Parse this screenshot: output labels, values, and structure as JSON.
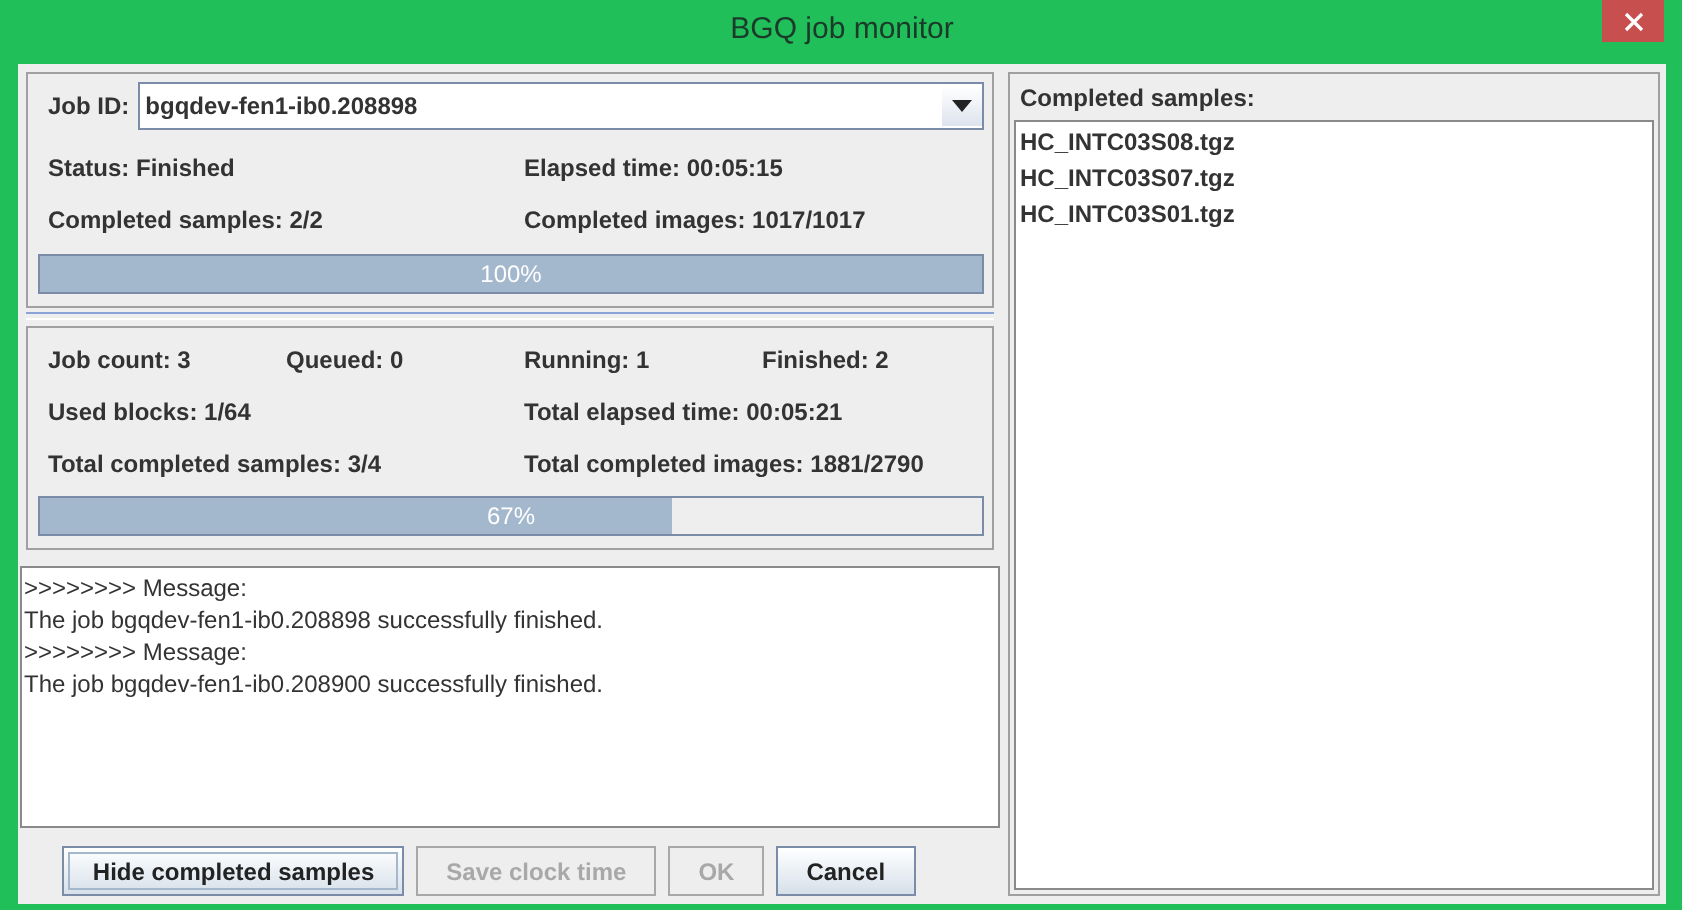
{
  "window": {
    "title": "BGQ job monitor"
  },
  "job_panel": {
    "job_id_label": "Job ID:",
    "job_id": "bgqdev-fen1-ib0.208898",
    "rows": [
      [
        {
          "label": "Status:",
          "value": "Finished"
        },
        {
          "label": "Elapsed time:",
          "value": "00:05:15"
        }
      ],
      [
        {
          "label": "Completed samples:",
          "value": "2/2"
        },
        {
          "label": "Completed images:",
          "value": "1017/1017"
        }
      ]
    ],
    "progress": {
      "level": 1.0,
      "text": "100%"
    }
  },
  "summary_panel": {
    "rows": [
      [
        {
          "label": "Job count:",
          "value": "3"
        },
        {
          "label": "Queued:",
          "value": "0"
        },
        {
          "label": "Running:",
          "value": "1"
        },
        {
          "label": "Finished:",
          "value": "2"
        }
      ],
      [
        {
          "label": "Used blocks:",
          "value": "1/64"
        },
        {
          "label": "Total elapsed time:",
          "value": "00:05:21"
        }
      ],
      [
        {
          "label": "Total completed samples:",
          "value": "3/4"
        },
        {
          "label": "Total completed images:",
          "value": "1881/2790"
        }
      ]
    ],
    "progress": {
      "level": 0.67,
      "text": "67%"
    }
  },
  "messages": [
    ">>>>>>>> Message:",
    "The job bgqdev-fen1-ib0.208898 successfully finished.",
    ">>>>>>>> Message:",
    "The job bgqdev-fen1-ib0.208900 successfully finished."
  ],
  "buttons": [
    {
      "label": "Hide completed samples",
      "disabled": false,
      "focused": true
    },
    {
      "label": "Save clock time",
      "disabled": true,
      "focused": false
    },
    {
      "label": "OK",
      "disabled": true,
      "focused": false
    },
    {
      "label": "Cancel",
      "disabled": false,
      "focused": false
    }
  ],
  "completed_samples": {
    "title": "Completed samples:",
    "items": [
      "HC_INTC03S08.tgz",
      "HC_INTC03S07.tgz",
      "HC_INTC03S01.tgz"
    ]
  }
}
